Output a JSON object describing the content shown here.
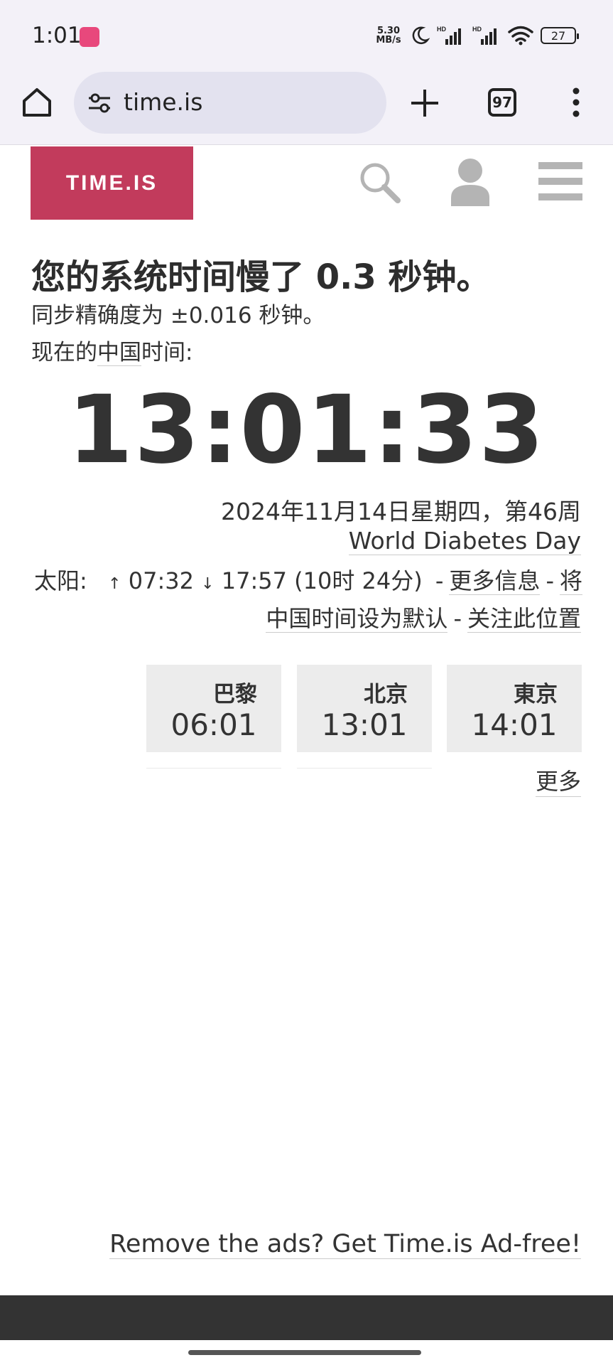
{
  "status_bar": {
    "time": "1:01",
    "net_speed": "5.30 MB/s",
    "battery": "27",
    "icons": [
      "app-notification-icon",
      "moon-icon",
      "signal-hd-icon",
      "signal-hd-icon",
      "wifi-icon",
      "battery-icon"
    ]
  },
  "browser": {
    "url": "time.is",
    "tab_count": "97",
    "icons": [
      "home-icon",
      "site-settings-icon",
      "plus-icon",
      "tabs-icon",
      "more-vert-icon"
    ]
  },
  "site": {
    "logo": "TIME.IS",
    "icons": [
      "search-icon",
      "user-icon",
      "hamburger-menu-icon"
    ]
  },
  "main": {
    "headline": "您的系统时间慢了 0.3 秒钟。",
    "sync_prefix": "同步精确度为 ±0.016 秒钟。",
    "now_prefix": "现在的",
    "now_link": "中国",
    "now_suffix": "时间:",
    "clock": "13:01:33",
    "date": "2024年11月14日星期四，第46周",
    "holiday": "World Diabetes Day",
    "sun_label": "太阳:",
    "sunrise_arrow": "↑",
    "sunrise": "07:32",
    "sunset_arrow": "↓",
    "sunset": "17:57",
    "day_length": "(10时 24分)",
    "dash": "-",
    "more_info_link": "更多信息",
    "set_default_link_part1": "将",
    "set_default_link_part2": "中国时间设为默认",
    "follow_link": "关注此位置"
  },
  "cities": [
    {
      "name": "巴黎",
      "time": "06:01"
    },
    {
      "name": "北京",
      "time": "13:01"
    },
    {
      "name": "東京",
      "time": "14:01"
    }
  ],
  "more_link": "更多",
  "adfree_link": "Remove the ads? Get Time.is Ad-free!"
}
